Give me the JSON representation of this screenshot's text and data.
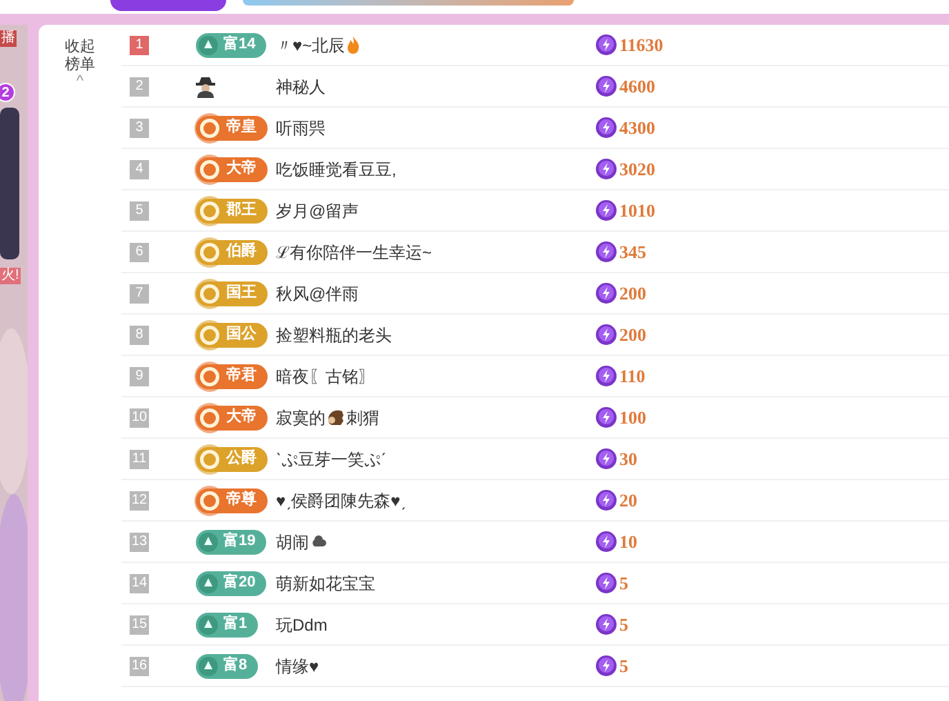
{
  "side_stream": {
    "tag": "播",
    "count": "2",
    "label": "火!"
  },
  "collapse": {
    "label": "收起榜单",
    "arrow": "^"
  },
  "rows": [
    {
      "rank": "1",
      "top": true,
      "badge": {
        "kind": "wealth",
        "text": "富14"
      },
      "name": [
        {
          "kind": "text",
          "text": "〃♥~北辰"
        },
        {
          "kind": "flame"
        }
      ]
    },
    {
      "rank": "2",
      "top": false,
      "badge": {
        "kind": "mystery"
      },
      "name": [
        {
          "kind": "text",
          "text": "神秘人"
        }
      ]
    },
    {
      "rank": "3",
      "top": false,
      "badge": {
        "kind": "noble",
        "text": "帝皇",
        "color": "#e8742e"
      },
      "name": [
        {
          "kind": "text",
          "text": "听雨巺"
        }
      ]
    },
    {
      "rank": "4",
      "top": false,
      "badge": {
        "kind": "noble",
        "text": "大帝",
        "color": "#e8742e"
      },
      "name": [
        {
          "kind": "text",
          "text": "吃饭睡觉看豆豆,"
        }
      ]
    },
    {
      "rank": "5",
      "top": false,
      "badge": {
        "kind": "noble",
        "text": "郡王",
        "color": "#dca22a"
      },
      "name": [
        {
          "kind": "text",
          "text": "岁月@留声"
        }
      ]
    },
    {
      "rank": "6",
      "top": false,
      "badge": {
        "kind": "noble",
        "text": "伯爵",
        "color": "#dca22a"
      },
      "name": [
        {
          "kind": "text",
          "text": "ℒ有你陪伴一生幸运~"
        }
      ]
    },
    {
      "rank": "7",
      "top": false,
      "badge": {
        "kind": "noble",
        "text": "国王",
        "color": "#dca22a"
      },
      "name": [
        {
          "kind": "text",
          "text": "秋风@伴雨"
        }
      ]
    },
    {
      "rank": "8",
      "top": false,
      "badge": {
        "kind": "noble",
        "text": "国公",
        "color": "#dca22a"
      },
      "name": [
        {
          "kind": "text",
          "text": "捡塑料瓶的老头"
        }
      ]
    },
    {
      "rank": "9",
      "top": false,
      "badge": {
        "kind": "noble",
        "text": "帝君",
        "color": "#e8742e"
      },
      "name": [
        {
          "kind": "text",
          "text": "暗夜〖古铭〗"
        }
      ]
    },
    {
      "rank": "10",
      "top": false,
      "badge": {
        "kind": "noble",
        "text": "大帝",
        "color": "#e8742e"
      },
      "name": [
        {
          "kind": "text",
          "text": "寂寞的"
        },
        {
          "kind": "hedgehog"
        },
        {
          "kind": "text",
          "text": "刺猬"
        }
      ]
    },
    {
      "rank": "11",
      "top": false,
      "badge": {
        "kind": "noble",
        "text": "公爵",
        "color": "#dca22a"
      },
      "name": [
        {
          "kind": "text",
          "text": "ˋぷ豆芽一笑ぷˊ"
        }
      ]
    },
    {
      "rank": "12",
      "top": false,
      "badge": {
        "kind": "noble",
        "text": "帝尊",
        "color": "#e8742e"
      },
      "name": [
        {
          "kind": "text",
          "text": "♥ˏ侯爵团陳先森♥ˏ"
        }
      ]
    },
    {
      "rank": "13",
      "top": false,
      "badge": {
        "kind": "wealth",
        "text": "富19"
      },
      "name": [
        {
          "kind": "text",
          "text": "胡闹"
        },
        {
          "kind": "cloud"
        }
      ]
    },
    {
      "rank": "14",
      "top": false,
      "badge": {
        "kind": "wealth",
        "text": "富20"
      },
      "name": [
        {
          "kind": "text",
          "text": "萌新如花宝宝"
        }
      ]
    },
    {
      "rank": "15",
      "top": false,
      "badge": {
        "kind": "wealth",
        "text": "富1"
      },
      "name": [
        {
          "kind": "text",
          "text": "玩Ddm"
        }
      ]
    },
    {
      "rank": "16",
      "top": false,
      "badge": {
        "kind": "wealth",
        "text": "富8"
      },
      "name": [
        {
          "kind": "text",
          "text": "情缘♥"
        }
      ]
    }
  ],
  "scores": [
    "11630",
    "4600",
    "4300",
    "3020",
    "1010",
    "345",
    "200",
    "200",
    "110",
    "100",
    "30",
    "20",
    "10",
    "5",
    "5",
    "5"
  ]
}
